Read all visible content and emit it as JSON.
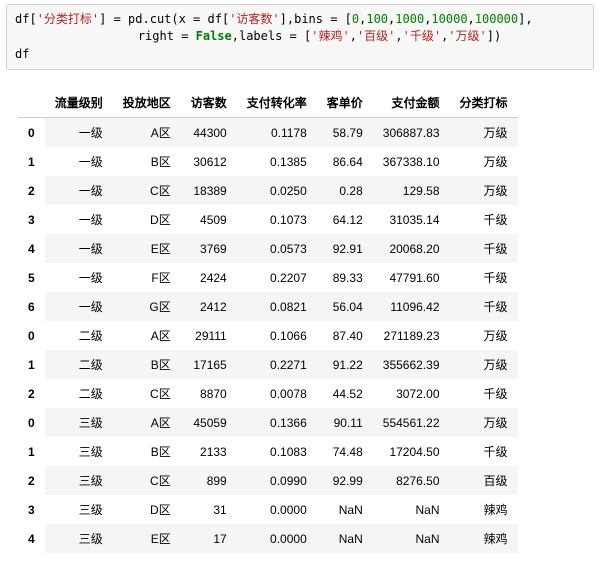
{
  "code": {
    "l1a": "df[",
    "l1str1": "'分类打标'",
    "l1b": "] = pd.cut(x = df[",
    "l1str2": "'访客数'",
    "l1c": "],bins = [",
    "l1n1": "0",
    "l1n2": "100",
    "l1n3": "1000",
    "l1n4": "10000",
    "l1n5": "100000",
    "l1d": "],",
    "l2pad": "                 ",
    "l2a": "right = ",
    "l2kw": "False",
    "l2b": ",labels = [",
    "l2s1": "'辣鸡'",
    "l2s2": "'百级'",
    "l2s3": "'千级'",
    "l2s4": "'万级'",
    "l2c": "])",
    "l3": "df"
  },
  "table": {
    "columns": [
      "流量级别",
      "投放地区",
      "访客数",
      "支付转化率",
      "客单价",
      "支付金额",
      "分类打标"
    ],
    "rows": [
      {
        "idx": "0",
        "c": [
          "一级",
          "A区",
          "44300",
          "0.1178",
          "58.79",
          "306887.83",
          "万级"
        ]
      },
      {
        "idx": "1",
        "c": [
          "一级",
          "B区",
          "30612",
          "0.1385",
          "86.64",
          "367338.10",
          "万级"
        ]
      },
      {
        "idx": "2",
        "c": [
          "一级",
          "C区",
          "18389",
          "0.0250",
          "0.28",
          "129.58",
          "万级"
        ]
      },
      {
        "idx": "3",
        "c": [
          "一级",
          "D区",
          "4509",
          "0.1073",
          "64.12",
          "31035.14",
          "千级"
        ]
      },
      {
        "idx": "4",
        "c": [
          "一级",
          "E区",
          "3769",
          "0.0573",
          "92.91",
          "20068.20",
          "千级"
        ]
      },
      {
        "idx": "5",
        "c": [
          "一级",
          "F区",
          "2424",
          "0.2207",
          "89.33",
          "47791.60",
          "千级"
        ]
      },
      {
        "idx": "6",
        "c": [
          "一级",
          "G区",
          "2412",
          "0.0821",
          "56.04",
          "11096.42",
          "千级"
        ]
      },
      {
        "idx": "0",
        "c": [
          "二级",
          "A区",
          "29111",
          "0.1066",
          "87.40",
          "271189.23",
          "万级"
        ]
      },
      {
        "idx": "1",
        "c": [
          "二级",
          "B区",
          "17165",
          "0.2271",
          "91.22",
          "355662.39",
          "万级"
        ]
      },
      {
        "idx": "2",
        "c": [
          "二级",
          "C区",
          "8870",
          "0.0078",
          "44.52",
          "3072.00",
          "千级"
        ]
      },
      {
        "idx": "0",
        "c": [
          "三级",
          "A区",
          "45059",
          "0.1366",
          "90.11",
          "554561.22",
          "万级"
        ]
      },
      {
        "idx": "1",
        "c": [
          "三级",
          "B区",
          "2133",
          "0.1083",
          "74.48",
          "17204.50",
          "千级"
        ]
      },
      {
        "idx": "2",
        "c": [
          "三级",
          "C区",
          "899",
          "0.0990",
          "92.99",
          "8276.50",
          "百级"
        ]
      },
      {
        "idx": "3",
        "c": [
          "三级",
          "D区",
          "31",
          "0.0000",
          "NaN",
          "NaN",
          "辣鸡"
        ]
      },
      {
        "idx": "4",
        "c": [
          "三级",
          "E区",
          "17",
          "0.0000",
          "NaN",
          "NaN",
          "辣鸡"
        ]
      }
    ]
  }
}
